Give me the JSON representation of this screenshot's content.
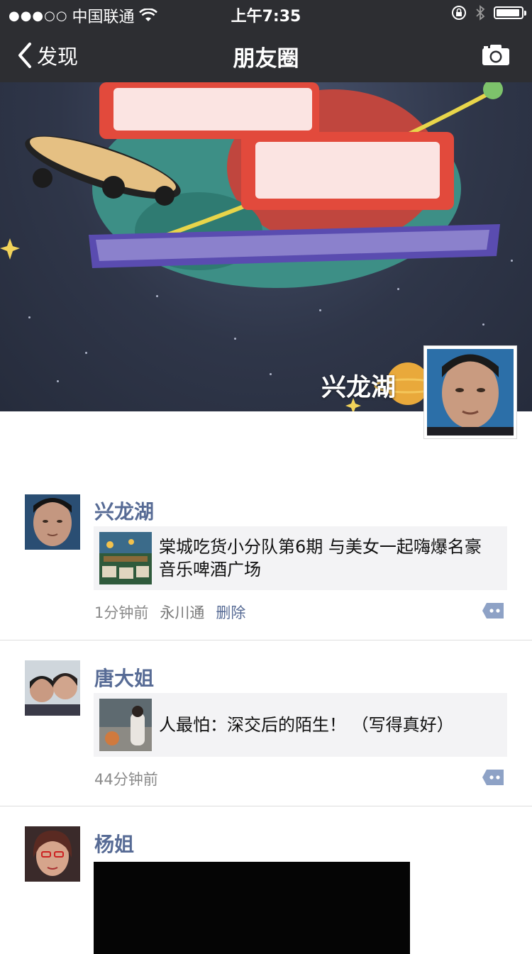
{
  "status_bar": {
    "signal": "●●●○○",
    "carrier": "中国联通",
    "time": "上午7:35"
  },
  "nav": {
    "back_label": "发现",
    "title": "朋友圈"
  },
  "cover": {
    "user_name": "兴龙湖"
  },
  "posts": [
    {
      "name": "兴龙湖",
      "link_title": "棠城吃货小分队第6期 与美女一起嗨爆名豪音乐啤酒广场",
      "time": "1分钟前",
      "location": "永川通",
      "delete_label": "删除"
    },
    {
      "name": "唐大姐",
      "link_title": "人最怕：深交后的陌生！ （写得真好）",
      "time": "44分钟前"
    },
    {
      "name": "杨姐"
    }
  ],
  "colors": {
    "bar_bg": "#2d2e32",
    "name_blue": "#576b95",
    "card_bg": "#f3f3f5",
    "meta_gray": "#8a8a8a"
  },
  "icons": [
    "back-chevron-icon",
    "camera-icon",
    "wifi-icon",
    "lock-rotation-icon",
    "bluetooth-icon",
    "battery-icon",
    "comment-icon"
  ]
}
